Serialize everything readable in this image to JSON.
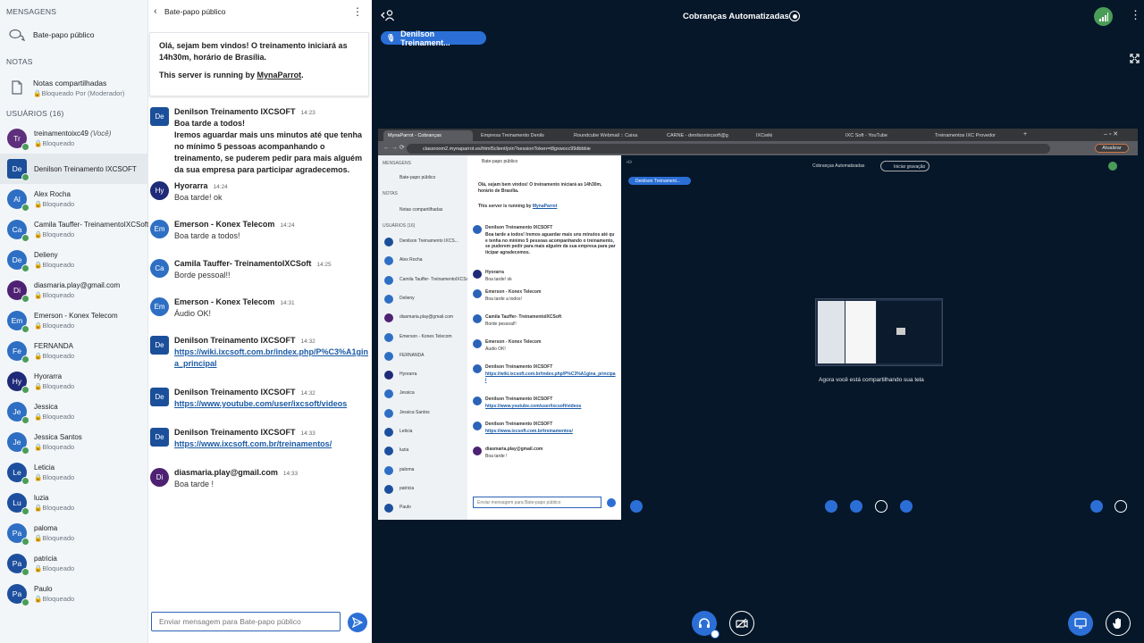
{
  "sidebar": {
    "messages_title": "MENSAGENS",
    "public_chat_label": "Bate-papo público",
    "notes_title": "NOTAS",
    "shared_notes_label": "Notas compartilhadas",
    "shared_notes_status": "Bloqueado Por (Moderador)",
    "users_title": "USUÁRIOS (16)",
    "users": [
      {
        "initials": "Tr",
        "name": "treinamentoixc49",
        "you": "(Você)",
        "status": "Bloqueado",
        "color": "#5d2f7c"
      },
      {
        "initials": "De",
        "name": "Denilson Treinamento IXCSOFT",
        "you": "",
        "status": "",
        "color": "#1b4f9a"
      },
      {
        "initials": "Al",
        "name": "Alex Rocha",
        "you": "",
        "status": "Bloqueado",
        "color": "#2e6fc4"
      },
      {
        "initials": "Ca",
        "name": "Camila Tauffer- TreinamentoIXCSoft",
        "you": "",
        "status": "Bloqueado",
        "color": "#2e6fc4"
      },
      {
        "initials": "De",
        "name": "Delieny",
        "you": "",
        "status": "Bloqueado",
        "color": "#2e6fc4"
      },
      {
        "initials": "Di",
        "name": "diasmaria.play@gmail.com",
        "you": "",
        "status": "Bloqueado",
        "color": "#4e2173"
      },
      {
        "initials": "Em",
        "name": "Emerson - Konex Telecom",
        "you": "",
        "status": "Bloqueado",
        "color": "#2e6fc4"
      },
      {
        "initials": "Fe",
        "name": "FERNANDA",
        "you": "",
        "status": "Bloqueado",
        "color": "#2e6fc4"
      },
      {
        "initials": "Hy",
        "name": "Hyorarra",
        "you": "",
        "status": "Bloqueado",
        "color": "#1f2a78"
      },
      {
        "initials": "Je",
        "name": "Jessica",
        "you": "",
        "status": "Bloqueado",
        "color": "#2e6fc4"
      },
      {
        "initials": "Je",
        "name": "Jessica Santos",
        "you": "",
        "status": "Bloqueado",
        "color": "#2e6fc4"
      },
      {
        "initials": "Le",
        "name": "Leticia",
        "you": "",
        "status": "Bloqueado",
        "color": "#1d4f9e"
      },
      {
        "initials": "Lu",
        "name": "luzia",
        "you": "",
        "status": "Bloqueado",
        "color": "#1d4f9e"
      },
      {
        "initials": "Pa",
        "name": "paloma",
        "you": "",
        "status": "Bloqueado",
        "color": "#2e6fc4"
      },
      {
        "initials": "Pa",
        "name": "patricia",
        "you": "",
        "status": "Bloqueado",
        "color": "#1d4f9e"
      },
      {
        "initials": "Pa",
        "name": "Paulo",
        "you": "",
        "status": "Bloqueado",
        "color": "#1d4f9e"
      }
    ]
  },
  "chat": {
    "title": "Bate-papo público",
    "welcome_line1": "Olá, sejam bem vindos! O treinamento iniciará as 14h30m, horário de Brasília.",
    "welcome_line2_prefix": "This server is running by",
    "welcome_line2_link": "MynaParrot",
    "welcome_line2_suffix": ".",
    "messages": [
      {
        "initials": "De",
        "author": "Denilson Treinamento IXCSOFT",
        "time": "14:23",
        "text": "Boa tarde a todos!\nIremos aguardar mais uns minutos até que tenha no mínimo 5 pessoas acompanhando o treinamento, se puderem pedir para mais alguém da sua empresa para participar agradecemos."
      },
      {
        "initials": "Hy",
        "author": "Hyorarra",
        "time": "14:24",
        "text": "Boa tarde! ok"
      },
      {
        "initials": "Em",
        "author": "Emerson - Konex Telecom",
        "time": "14:24",
        "text": "Boa tarde a todos!"
      },
      {
        "initials": "Ca",
        "author": "Camila Tauffer- TreinamentoIXCSoft",
        "time": "14:25",
        "text": "Borde pessoal!!"
      },
      {
        "initials": "Em",
        "author": "Emerson - Konex Telecom",
        "time": "14:31",
        "text": "Áudio OK!"
      },
      {
        "initials": "De",
        "author": "Denilson Treinamento IXCSOFT",
        "time": "14:32",
        "link": "https://wiki.ixcsoft.com.br/index.php/P%C3%A1gina_principal"
      },
      {
        "initials": "De",
        "author": "Denilson Treinamento IXCSOFT",
        "time": "14:32",
        "link": "https://www.youtube.com/user/ixcsoft/videos"
      },
      {
        "initials": "De",
        "author": "Denilson Treinamento IXCSOFT",
        "time": "14:33",
        "link": "https://www.ixcsoft.com.br/treinamentos/"
      },
      {
        "initials": "Di",
        "author": "diasmaria.play@gmail.com",
        "time": "14:33",
        "text": "Boa tarde !"
      }
    ],
    "input_placeholder": "Enviar mensagem para Bate-papo público"
  },
  "main": {
    "title": "Cobranças Automatizadas",
    "presenter": "Denilson Treinament...",
    "screen": {
      "tabs": [
        "MynaParrot - Cobranças",
        "Empresa Treinamento Denils",
        "Roundcube Webmail :: Caixa",
        "CARNE - denilsonixcsoft@g",
        "IXCwiki",
        "IXC Soft - YouTube",
        "Treinamentos IXC Provedor"
      ],
      "url": "classroom2.mynaparrot.es/html5client/join?sessionToken=t8gxwocc99dbbbie",
      "update_button": "Atualizar",
      "nested_title": "Cobranças Automatizadas",
      "nested_record": "Iniciar gravação",
      "nested_presenter": "Denilson Treinament...",
      "sharing_text": "Agora você está compartilhando sua tela",
      "nested_input_placeholder": "Enviar mensagem para Bate-papo público",
      "nested_users_title": "USUÁRIOS (16)",
      "nested_users": [
        "Denilson Treinamento IXCS...",
        "Alex Rocha",
        "Camila Tauffer- TreinamentoIXCSoft",
        "Delieny",
        "diasmaria.play@gmail.com",
        "Emerson - Konex Telecom",
        "FERNANDA",
        "Hyorarra",
        "Jessica",
        "Jessica Santos",
        "Leticia",
        "luzia",
        "paloma",
        "patricia",
        "Paulo"
      ]
    }
  },
  "colors": {
    "accent": "#2b6fd6",
    "dark_bg": "#06172a",
    "online": "#4a9d57"
  }
}
